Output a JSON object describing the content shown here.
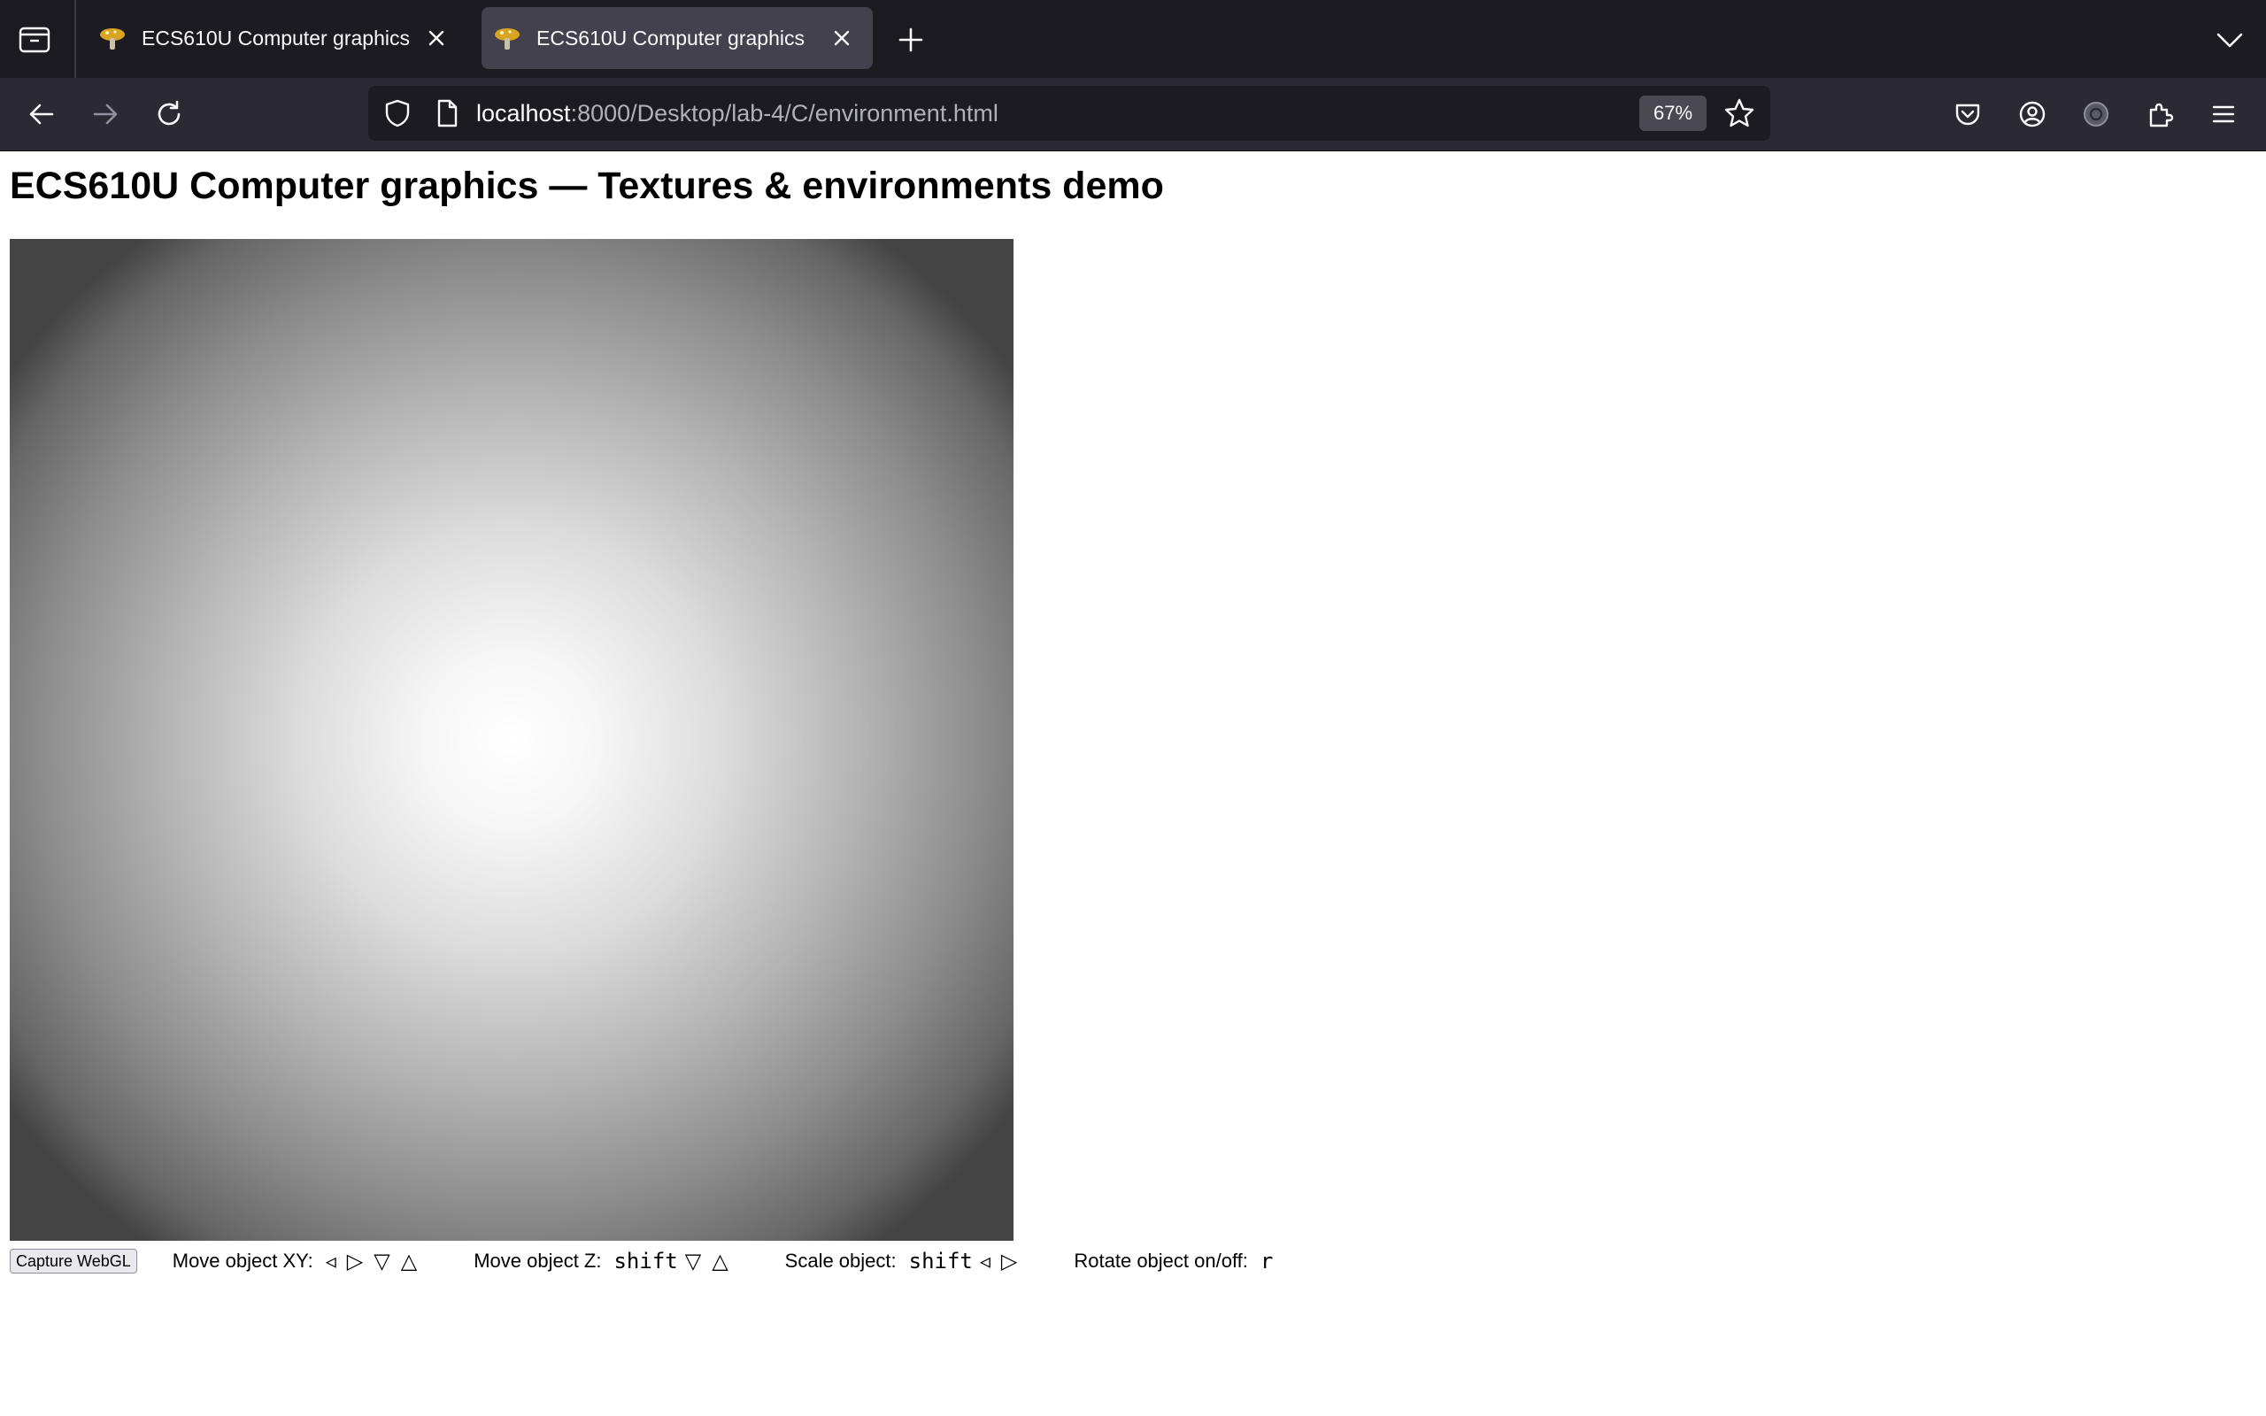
{
  "browser": {
    "tabs": [
      {
        "title": "ECS610U Computer graphics",
        "active": false
      },
      {
        "title": "ECS610U Computer graphics",
        "active": true
      }
    ],
    "url": {
      "host": "localhost",
      "path": ":8000/Desktop/lab-4/C/environment.html"
    },
    "zoom": "67%"
  },
  "page": {
    "title": "ECS610U Computer graphics — Textures & environments demo",
    "capture_button": "Capture WebGL",
    "controls": [
      {
        "label": "Move object XY:",
        "key": "",
        "glyphs": [
          "◃",
          "▷",
          "▽",
          "△"
        ]
      },
      {
        "label": "Move object Z:",
        "key": "shift",
        "glyphs": [
          "▽",
          "△"
        ]
      },
      {
        "label": "Scale object:",
        "key": "shift",
        "glyphs": [
          "◃",
          "▷"
        ]
      },
      {
        "label": "Rotate object on/off:",
        "key": "r",
        "glyphs": []
      }
    ]
  },
  "colors": {
    "tabbar_bg": "#1c1b22",
    "navbar_bg": "#2b2a33",
    "active_tab_bg": "#42414d"
  }
}
